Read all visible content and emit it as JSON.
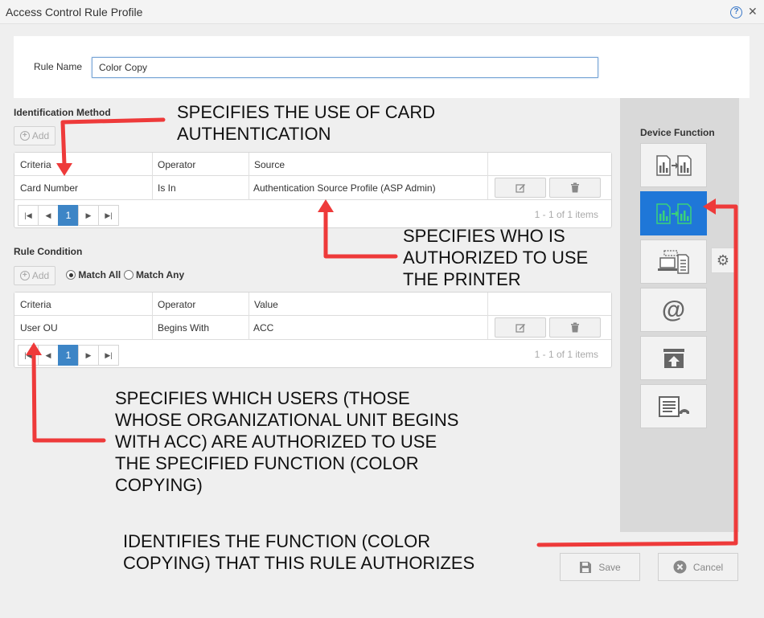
{
  "window": {
    "title": "Access Control Rule Profile"
  },
  "rule_name": {
    "label": "Rule Name",
    "value": "Color Copy"
  },
  "identification": {
    "section_label": "Identification Method",
    "add_label": "Add",
    "columns": [
      "Criteria",
      "Operator",
      "Source"
    ],
    "rows": [
      {
        "criteria": "Card Number",
        "operator": "Is In",
        "value": "Authentication Source Profile (ASP Admin)"
      }
    ],
    "pager": {
      "page": "1",
      "info": "1 - 1 of 1 items"
    }
  },
  "condition": {
    "section_label": "Rule Condition",
    "add_label": "Add",
    "match_all": "Match All",
    "match_any": "Match Any",
    "columns": [
      "Criteria",
      "Operator",
      "Value"
    ],
    "rows": [
      {
        "criteria": "User OU",
        "operator": "Begins With",
        "value": "ACC"
      }
    ],
    "pager": {
      "page": "1",
      "info": "1 - 1 of 1 items"
    }
  },
  "device_function": {
    "label": "Device Function",
    "buttons": [
      "copy-icon",
      "color-copy-icon",
      "scan-to-pc-icon",
      "email-icon",
      "upload-icon",
      "fax-icon"
    ],
    "selected": "color-copy-icon"
  },
  "footer": {
    "save_label": "Save",
    "cancel_label": "Cancel"
  },
  "annotations": {
    "card_auth": "SPECIFIES THE USE OF CARD\nAUTHENTICATION",
    "who_authorized": "SPECIFIES WHO IS\nAUTHORIZED TO USE\nTHE PRINTER",
    "which_users": "SPECIFIES WHICH USERS (THOSE\nWHOSE ORGANIZATIONAL UNIT BEGINS\nWITH ACC) ARE AUTHORIZED TO USE\nTHE SPECIFIED FUNCTION (COLOR\nCOPYING)",
    "function": "IDENTIFIES THE FUNCTION (COLOR\nCOPYING) THAT THIS RULE AUTHORIZES"
  },
  "colors": {
    "accent": "#3d85c6",
    "selected_function": "#1f77d8",
    "annotation_arrow": "#ee3a3a"
  }
}
